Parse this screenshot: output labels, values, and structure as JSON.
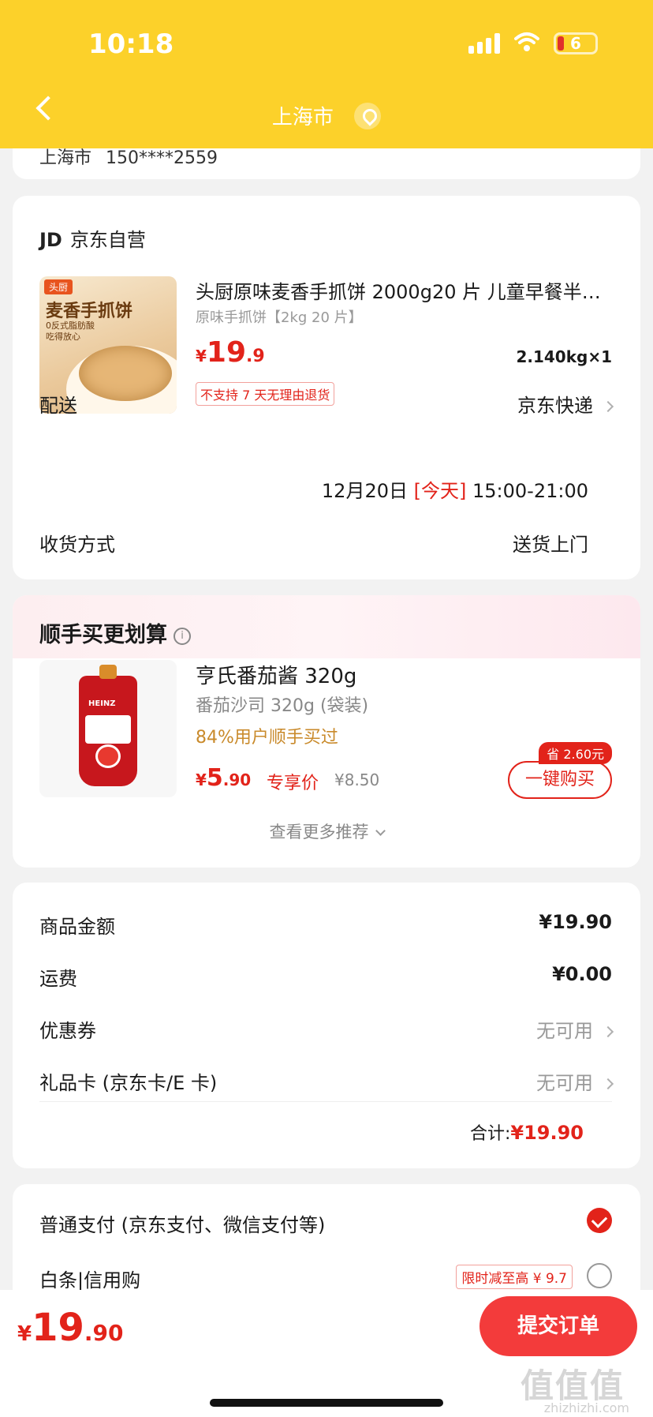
{
  "status_bar": {
    "time": "10:18",
    "battery": "6"
  },
  "header": {
    "title": "上海市"
  },
  "address": {
    "city": "上海市",
    "phone": "150****2559"
  },
  "order": {
    "store": {
      "logo": "JD",
      "name": "京东自营"
    },
    "product": {
      "image_tag": "头厨",
      "image_title": "麦香手抓饼",
      "image_subtitle": "0反式脂肪酸 吃得放心",
      "name": "头厨原味麦香手抓饼 2000g20 片 儿童早餐半…",
      "spec": "原味手抓饼【2kg 20 片】",
      "price_yen": "¥",
      "price_int": "19",
      "price_dec": ".9",
      "weight_qty": "2.140kg×1",
      "badge": "不支持 7 天无理由退货"
    },
    "delivery": {
      "label": "配送",
      "method": "京东快递",
      "date": "12月20日",
      "today": "[今天]",
      "window": "15:00-21:00"
    },
    "receive": {
      "label": "收货方式",
      "value": "送货上门"
    }
  },
  "recommend": {
    "title": "顺手买更划算",
    "item": {
      "brand_logo": "HEINZ",
      "name": "亨氏番茄酱 320g",
      "spec": "番茄沙司 320g (袋装)",
      "bought": "84%用户顺手买过",
      "price_yen": "¥",
      "price_int": "5",
      "price_dec": ".90",
      "exclusive": "专享价",
      "old_price": "¥8.50",
      "save_tag": "省 2.60元",
      "buy_label": "一键购买"
    },
    "more_label": "查看更多推荐"
  },
  "summary": {
    "rows": [
      {
        "label": "商品金额",
        "value": "¥19.90"
      },
      {
        "label": "运费",
        "value": "¥0.00"
      },
      {
        "label": "优惠券",
        "value": "无可用"
      },
      {
        "label": "礼品卡 (京东卡/E 卡)",
        "value": "无可用"
      }
    ],
    "total_label": "合计:",
    "total_value": "¥19.90"
  },
  "payment": {
    "options": [
      {
        "label": "普通支付 (京东支付、微信支付等)",
        "selected": true
      },
      {
        "label": "白条|信用购",
        "promo": "限时减至高 ¥ 9.7",
        "selected": false
      }
    ]
  },
  "bottom": {
    "price_yen": "¥",
    "price_int": "19",
    "price_dec": ".90",
    "submit_label": "提交订单",
    "watermark_logo": "值值值",
    "watermark_url": "zhizhizhi.com"
  },
  "colors": {
    "brand_yellow": "#fcd12a",
    "accent_red": "#e2231a",
    "submit_red": "#f33b3b"
  }
}
